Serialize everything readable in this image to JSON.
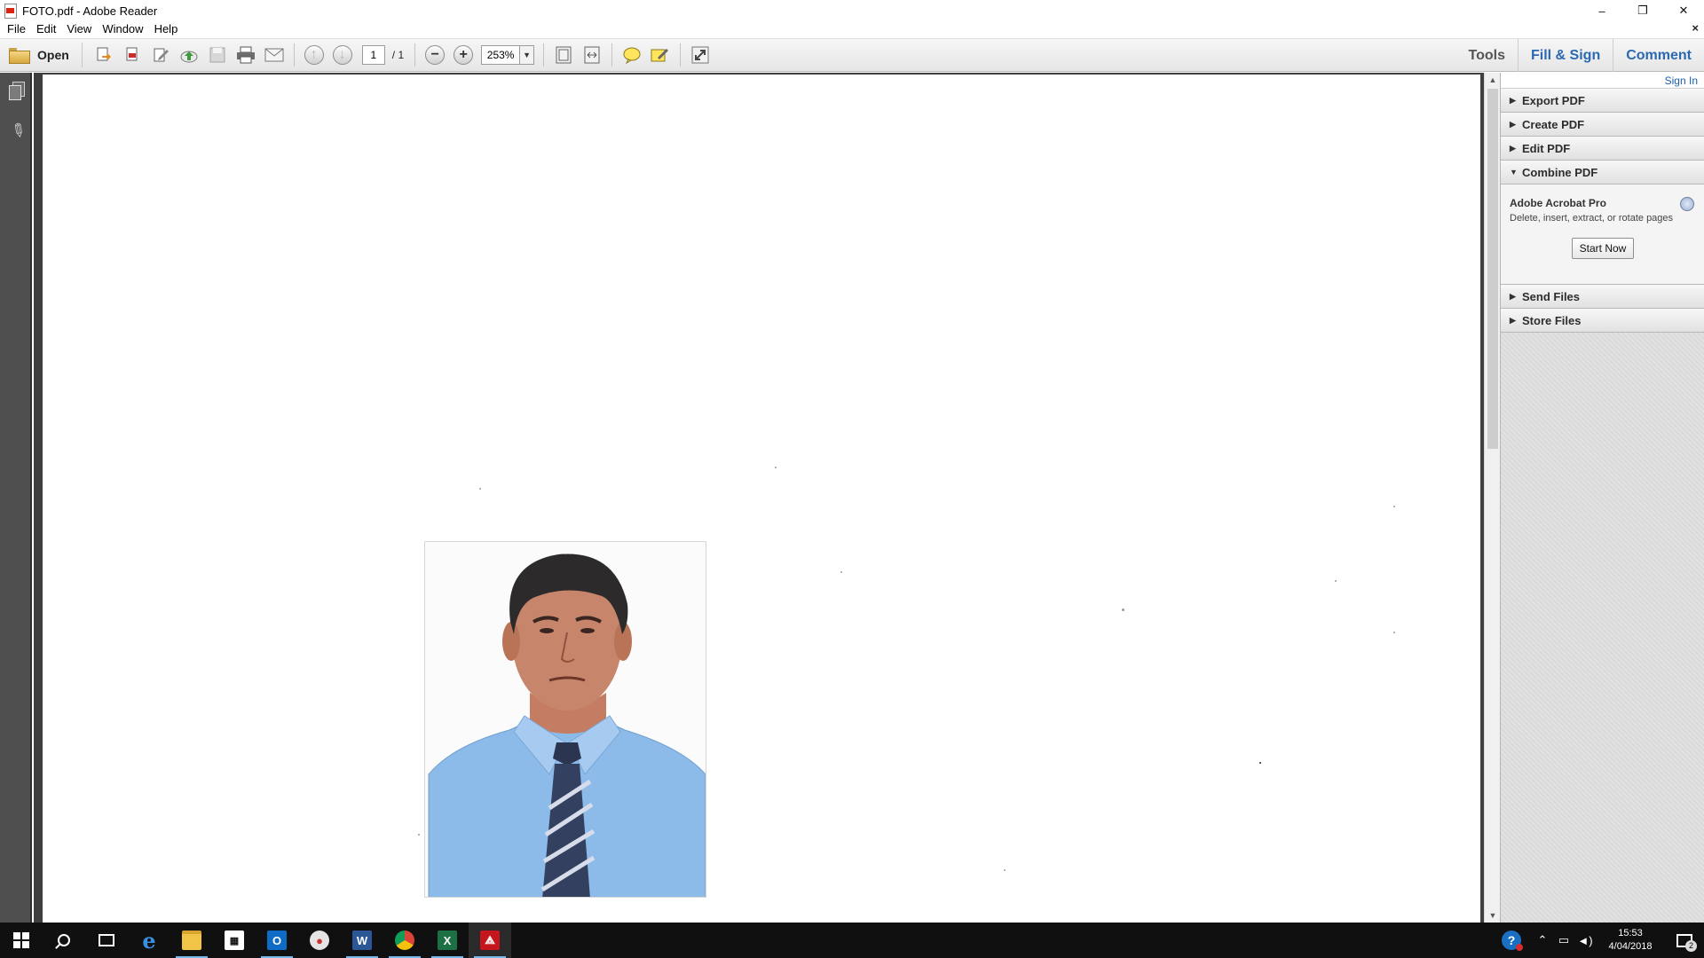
{
  "window": {
    "title": "FOTO.pdf - Adobe Reader",
    "controls": {
      "minimize": "–",
      "restore": "❐",
      "close": "✕"
    }
  },
  "menu": {
    "items": [
      "File",
      "Edit",
      "View",
      "Window",
      "Help"
    ],
    "doc_close": "×"
  },
  "toolbar": {
    "open_label": "Open",
    "page_current": "1",
    "page_total": "/ 1",
    "zoom": "253%",
    "tabs": {
      "tools": "Tools",
      "fill_sign": "Fill & Sign",
      "comment": "Comment"
    }
  },
  "right_pane": {
    "sign_in": "Sign In",
    "panels": [
      {
        "label": "Export PDF",
        "expanded": false
      },
      {
        "label": "Create PDF",
        "expanded": false
      },
      {
        "label": "Edit PDF",
        "expanded": false
      },
      {
        "label": "Combine PDF",
        "expanded": true
      },
      {
        "label": "Send Files",
        "expanded": false
      },
      {
        "label": "Store Files",
        "expanded": false
      }
    ],
    "combine": {
      "product": "Adobe Acrobat Pro",
      "description": "Delete, insert, extract, or rotate pages",
      "button": "Start Now"
    }
  },
  "taskbar": {
    "apps": [
      "start-icon",
      "search-icon",
      "task-view-icon",
      "edge-icon",
      "file-explorer-icon",
      "store-icon",
      "outlook-icon",
      "paint-icon",
      "word-icon",
      "chrome-icon",
      "excel-icon",
      "acrobat-icon"
    ],
    "clock_time": "15:53",
    "clock_date": "4/04/2018",
    "notification_count": "2"
  },
  "colors": {
    "accent": "#2c69b0",
    "nav_pane": "#4f4f4f",
    "taskbar": "#101010",
    "shirt": "#8cbbe9"
  }
}
